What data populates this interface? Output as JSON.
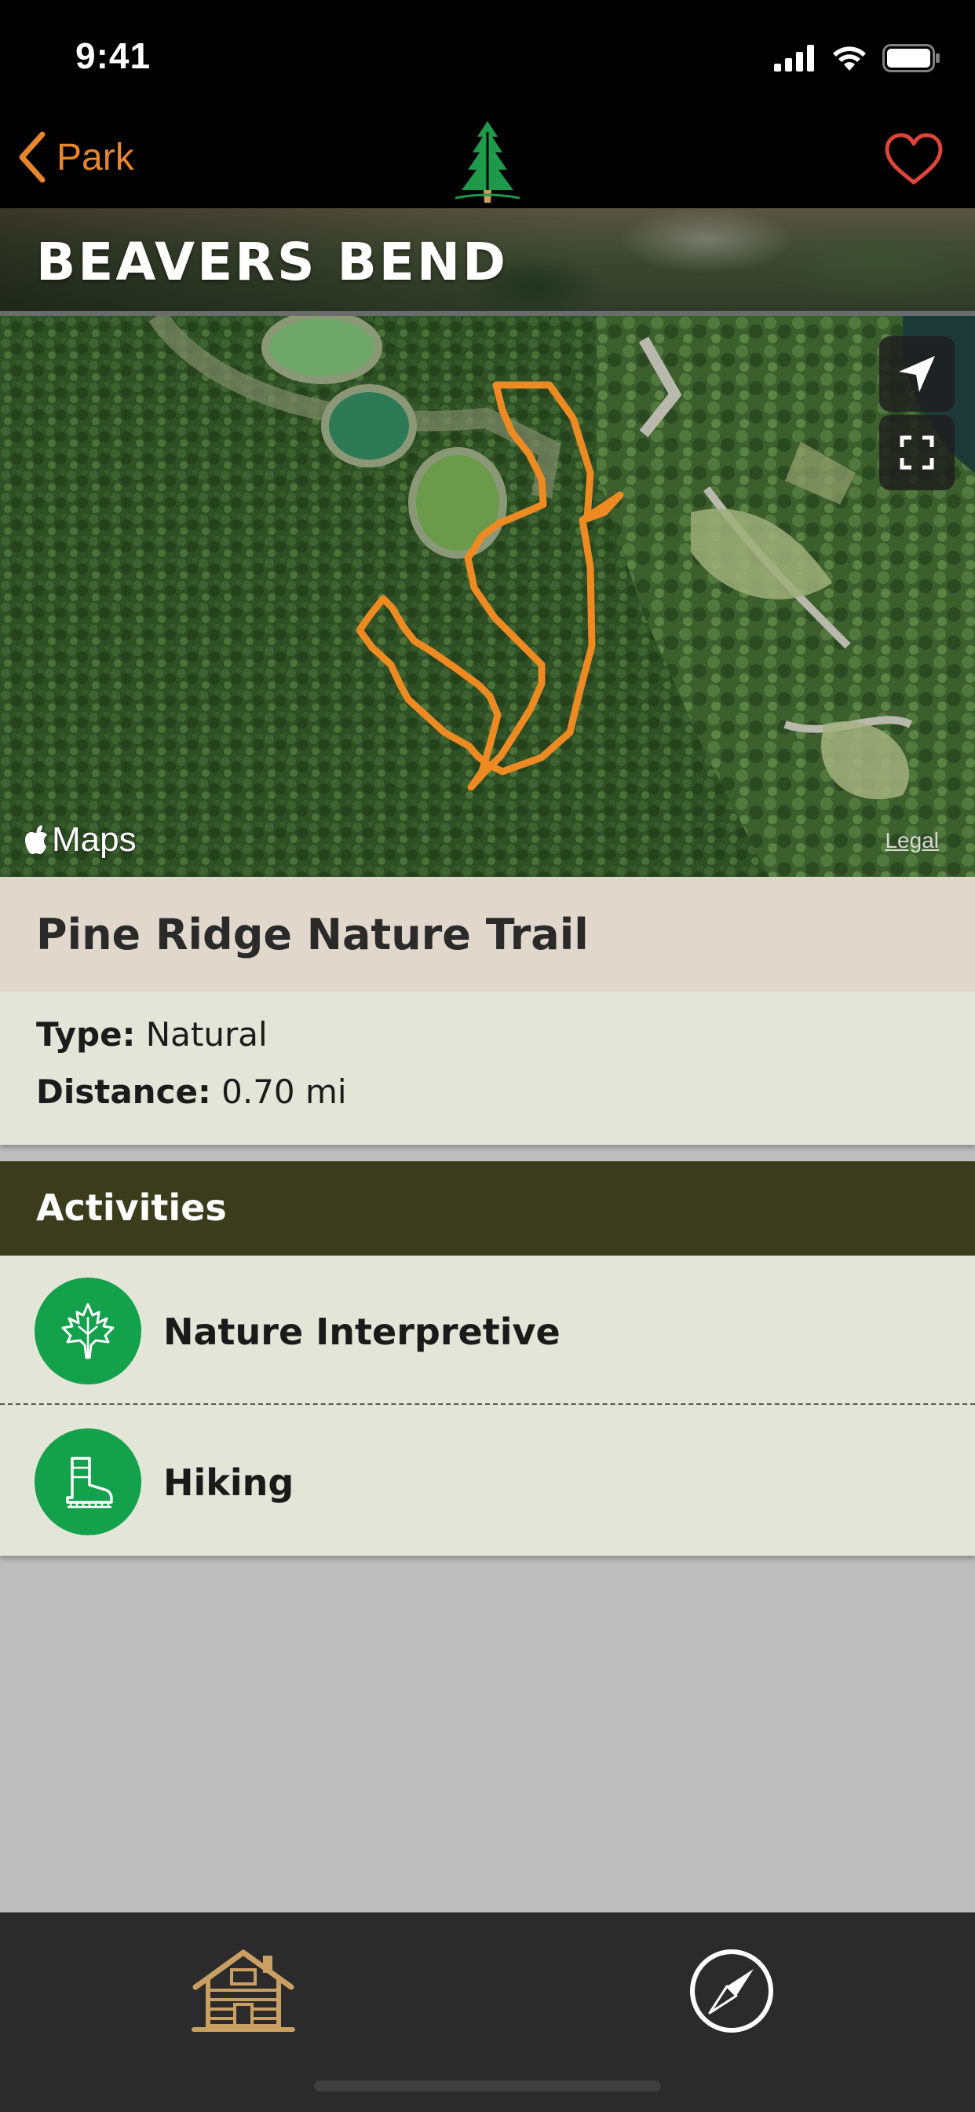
{
  "status_bar": {
    "time": "9:41"
  },
  "nav": {
    "back_label": "Park"
  },
  "banner": {
    "title": "BEAVERS BEND"
  },
  "map": {
    "brand": "Maps",
    "legal": "Legal"
  },
  "trail": {
    "name": "Pine Ridge Nature Trail",
    "type_label": "Type:",
    "type_value": "Natural",
    "distance_label": "Distance:",
    "distance_value": "0.70 mi"
  },
  "activities": {
    "title": "Activities",
    "items": [
      {
        "label": "Nature Interpretive",
        "icon": "maple-leaf-icon"
      },
      {
        "label": "Hiking",
        "icon": "hiking-boot-icon"
      }
    ]
  },
  "colors": {
    "accent": "#e7862d",
    "activity_green": "#14a14b",
    "activities_header": "#3a3c1c",
    "logo_green": "#1f9a4b"
  }
}
